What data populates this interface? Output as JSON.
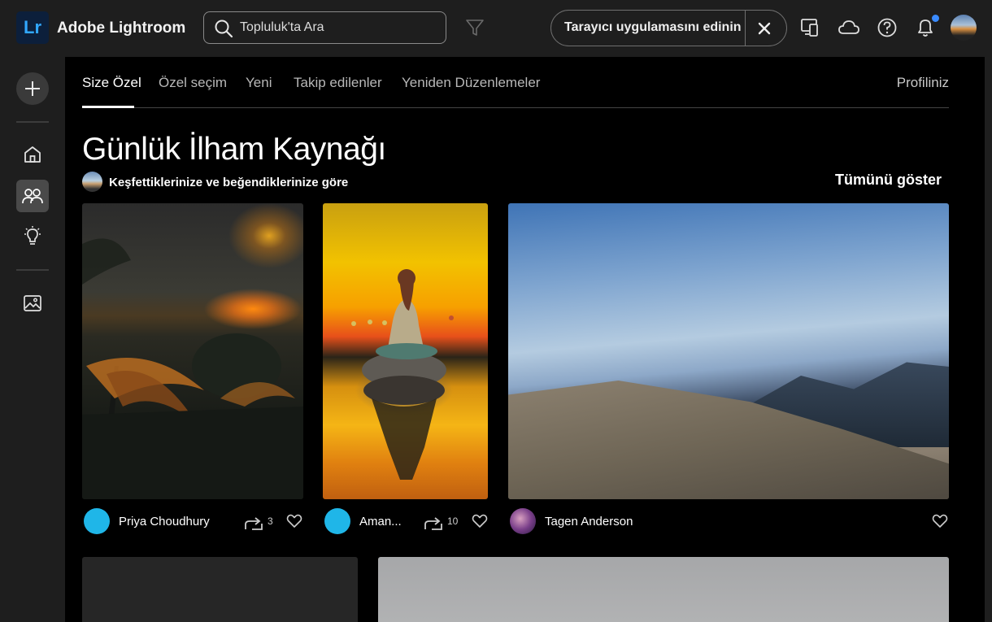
{
  "app": {
    "logo_text": "Lr",
    "name": "Adobe Lightroom"
  },
  "search": {
    "placeholder": "Topluluk'ta Ara"
  },
  "promo": {
    "label": "Tarayıcı uygulamasını edinin"
  },
  "tabs": [
    {
      "label": "Size Özel",
      "active": true
    },
    {
      "label": "Özel seçim"
    },
    {
      "label": "Yeni"
    },
    {
      "label": "Takip edilenler"
    },
    {
      "label": "Yeniden Düzenlemeler"
    }
  ],
  "profile_link": "Profiliniz",
  "section": {
    "title": "Günlük İlham Kaynağı",
    "subtitle": "Keşfettiklerinize ve beğendiklerinize göre",
    "show_all": "Tümünü göster"
  },
  "photos": [
    {
      "author": "Priya Choudhury",
      "remix_count": "3",
      "avatar_color": "#1fb6e8"
    },
    {
      "author": "Aman...",
      "remix_count": "10",
      "avatar_color": "#1fb6e8"
    },
    {
      "author": "Tagen Anderson",
      "avatar_color": "#7a3f8a"
    }
  ],
  "icons": [
    "search-icon",
    "filter-icon",
    "close-icon",
    "devices-icon",
    "cloud-icon",
    "help-icon",
    "bell-icon",
    "plus-icon",
    "home-icon",
    "community-icon",
    "lightbulb-icon",
    "photos-icon",
    "remix-icon",
    "heart-icon"
  ],
  "colors": {
    "accent": "#31a8ff",
    "logo_bg": "#0c1f3b",
    "notification": "#3a8bff"
  }
}
